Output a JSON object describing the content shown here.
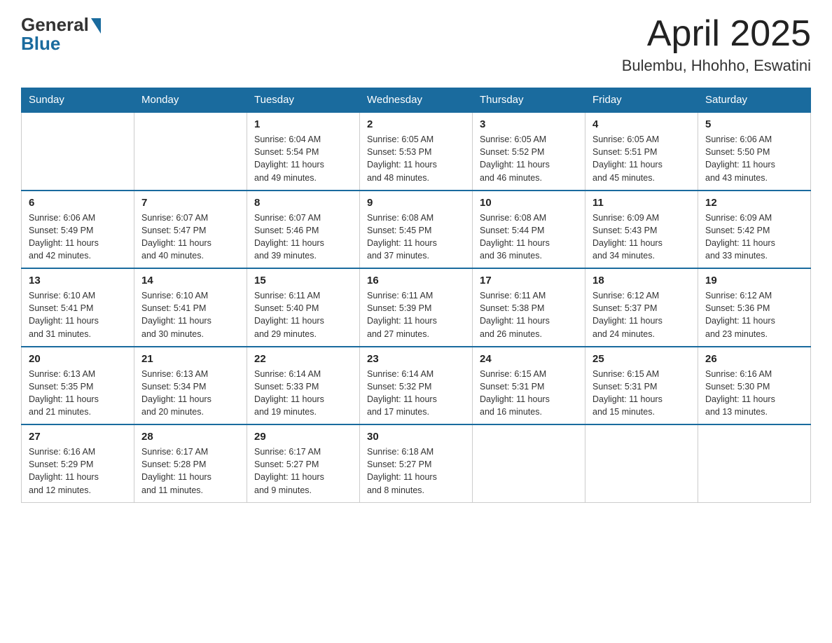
{
  "logo": {
    "general": "General",
    "blue": "Blue"
  },
  "title": "April 2025",
  "subtitle": "Bulembu, Hhohho, Eswatini",
  "days_of_week": [
    "Sunday",
    "Monday",
    "Tuesday",
    "Wednesday",
    "Thursday",
    "Friday",
    "Saturday"
  ],
  "weeks": [
    [
      {
        "day": "",
        "info": ""
      },
      {
        "day": "",
        "info": ""
      },
      {
        "day": "1",
        "info": "Sunrise: 6:04 AM\nSunset: 5:54 PM\nDaylight: 11 hours\nand 49 minutes."
      },
      {
        "day": "2",
        "info": "Sunrise: 6:05 AM\nSunset: 5:53 PM\nDaylight: 11 hours\nand 48 minutes."
      },
      {
        "day": "3",
        "info": "Sunrise: 6:05 AM\nSunset: 5:52 PM\nDaylight: 11 hours\nand 46 minutes."
      },
      {
        "day": "4",
        "info": "Sunrise: 6:05 AM\nSunset: 5:51 PM\nDaylight: 11 hours\nand 45 minutes."
      },
      {
        "day": "5",
        "info": "Sunrise: 6:06 AM\nSunset: 5:50 PM\nDaylight: 11 hours\nand 43 minutes."
      }
    ],
    [
      {
        "day": "6",
        "info": "Sunrise: 6:06 AM\nSunset: 5:49 PM\nDaylight: 11 hours\nand 42 minutes."
      },
      {
        "day": "7",
        "info": "Sunrise: 6:07 AM\nSunset: 5:47 PM\nDaylight: 11 hours\nand 40 minutes."
      },
      {
        "day": "8",
        "info": "Sunrise: 6:07 AM\nSunset: 5:46 PM\nDaylight: 11 hours\nand 39 minutes."
      },
      {
        "day": "9",
        "info": "Sunrise: 6:08 AM\nSunset: 5:45 PM\nDaylight: 11 hours\nand 37 minutes."
      },
      {
        "day": "10",
        "info": "Sunrise: 6:08 AM\nSunset: 5:44 PM\nDaylight: 11 hours\nand 36 minutes."
      },
      {
        "day": "11",
        "info": "Sunrise: 6:09 AM\nSunset: 5:43 PM\nDaylight: 11 hours\nand 34 minutes."
      },
      {
        "day": "12",
        "info": "Sunrise: 6:09 AM\nSunset: 5:42 PM\nDaylight: 11 hours\nand 33 minutes."
      }
    ],
    [
      {
        "day": "13",
        "info": "Sunrise: 6:10 AM\nSunset: 5:41 PM\nDaylight: 11 hours\nand 31 minutes."
      },
      {
        "day": "14",
        "info": "Sunrise: 6:10 AM\nSunset: 5:41 PM\nDaylight: 11 hours\nand 30 minutes."
      },
      {
        "day": "15",
        "info": "Sunrise: 6:11 AM\nSunset: 5:40 PM\nDaylight: 11 hours\nand 29 minutes."
      },
      {
        "day": "16",
        "info": "Sunrise: 6:11 AM\nSunset: 5:39 PM\nDaylight: 11 hours\nand 27 minutes."
      },
      {
        "day": "17",
        "info": "Sunrise: 6:11 AM\nSunset: 5:38 PM\nDaylight: 11 hours\nand 26 minutes."
      },
      {
        "day": "18",
        "info": "Sunrise: 6:12 AM\nSunset: 5:37 PM\nDaylight: 11 hours\nand 24 minutes."
      },
      {
        "day": "19",
        "info": "Sunrise: 6:12 AM\nSunset: 5:36 PM\nDaylight: 11 hours\nand 23 minutes."
      }
    ],
    [
      {
        "day": "20",
        "info": "Sunrise: 6:13 AM\nSunset: 5:35 PM\nDaylight: 11 hours\nand 21 minutes."
      },
      {
        "day": "21",
        "info": "Sunrise: 6:13 AM\nSunset: 5:34 PM\nDaylight: 11 hours\nand 20 minutes."
      },
      {
        "day": "22",
        "info": "Sunrise: 6:14 AM\nSunset: 5:33 PM\nDaylight: 11 hours\nand 19 minutes."
      },
      {
        "day": "23",
        "info": "Sunrise: 6:14 AM\nSunset: 5:32 PM\nDaylight: 11 hours\nand 17 minutes."
      },
      {
        "day": "24",
        "info": "Sunrise: 6:15 AM\nSunset: 5:31 PM\nDaylight: 11 hours\nand 16 minutes."
      },
      {
        "day": "25",
        "info": "Sunrise: 6:15 AM\nSunset: 5:31 PM\nDaylight: 11 hours\nand 15 minutes."
      },
      {
        "day": "26",
        "info": "Sunrise: 6:16 AM\nSunset: 5:30 PM\nDaylight: 11 hours\nand 13 minutes."
      }
    ],
    [
      {
        "day": "27",
        "info": "Sunrise: 6:16 AM\nSunset: 5:29 PM\nDaylight: 11 hours\nand 12 minutes."
      },
      {
        "day": "28",
        "info": "Sunrise: 6:17 AM\nSunset: 5:28 PM\nDaylight: 11 hours\nand 11 minutes."
      },
      {
        "day": "29",
        "info": "Sunrise: 6:17 AM\nSunset: 5:27 PM\nDaylight: 11 hours\nand 9 minutes."
      },
      {
        "day": "30",
        "info": "Sunrise: 6:18 AM\nSunset: 5:27 PM\nDaylight: 11 hours\nand 8 minutes."
      },
      {
        "day": "",
        "info": ""
      },
      {
        "day": "",
        "info": ""
      },
      {
        "day": "",
        "info": ""
      }
    ]
  ]
}
